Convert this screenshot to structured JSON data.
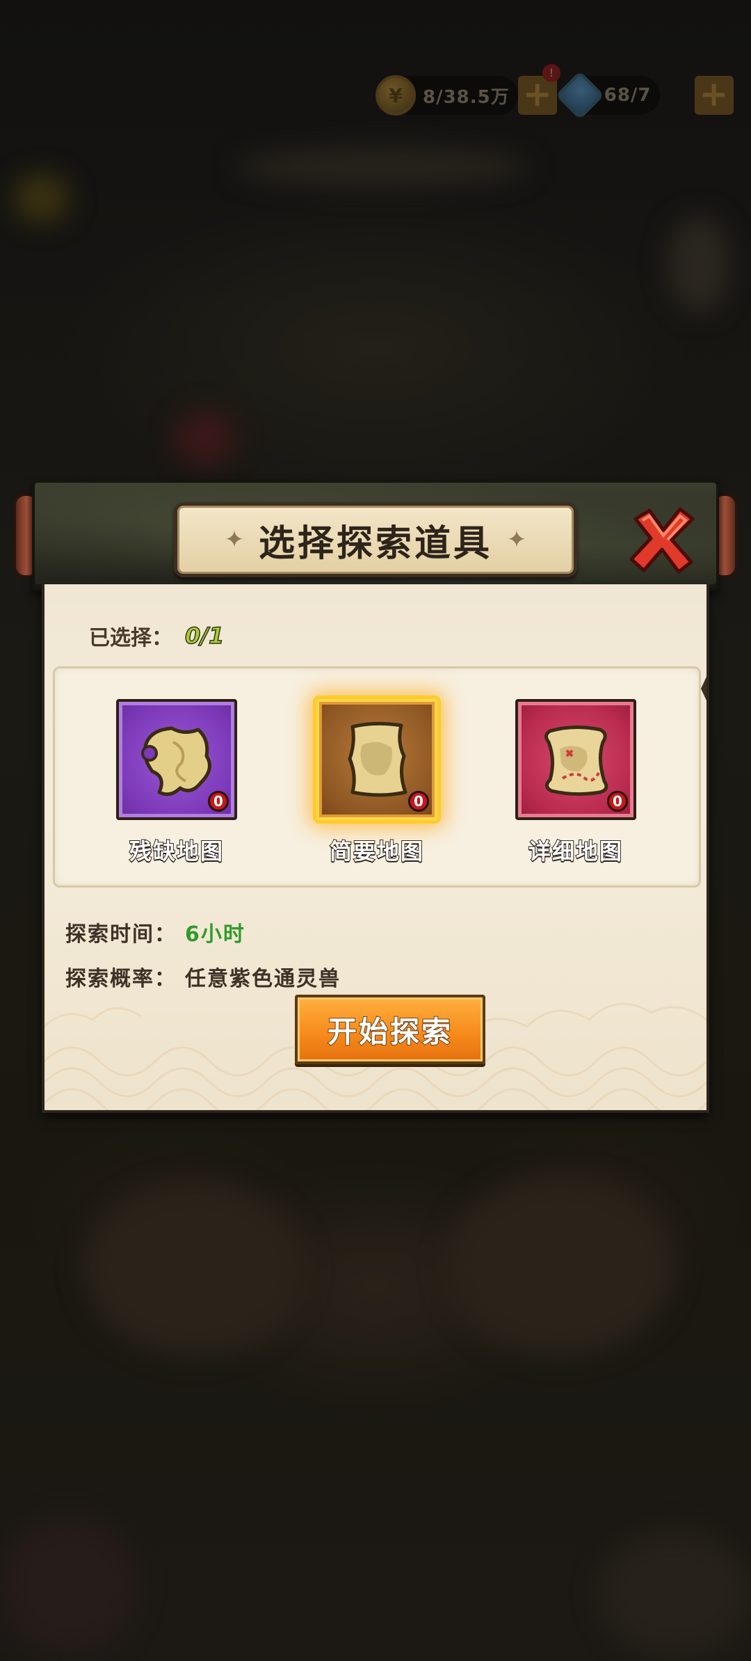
{
  "top_bar": {
    "gold_text": "8/38.5万",
    "gem_text": "68/7",
    "badge_text": "!"
  },
  "dialog": {
    "title": "选择探索道具",
    "selected_label": "已选择：",
    "selected_count": "0/1",
    "items": [
      {
        "label": "残缺地图",
        "count": "0",
        "frame_color": "#7c39b8",
        "icon": "broken-map-icon"
      },
      {
        "label": "简要地图",
        "count": "0",
        "frame_color": "#8f5824",
        "icon": "brief-map-icon",
        "selected": true
      },
      {
        "label": "详细地图",
        "count": "0",
        "frame_color": "#b82a4e",
        "icon": "detailed-map-icon"
      }
    ],
    "explore_time_label": "探索时间：",
    "explore_time_value": "6小时",
    "explore_chance_label": "探索概率：",
    "explore_chance_value": "任意紫色通灵兽",
    "start_button_label": "开始探索"
  }
}
